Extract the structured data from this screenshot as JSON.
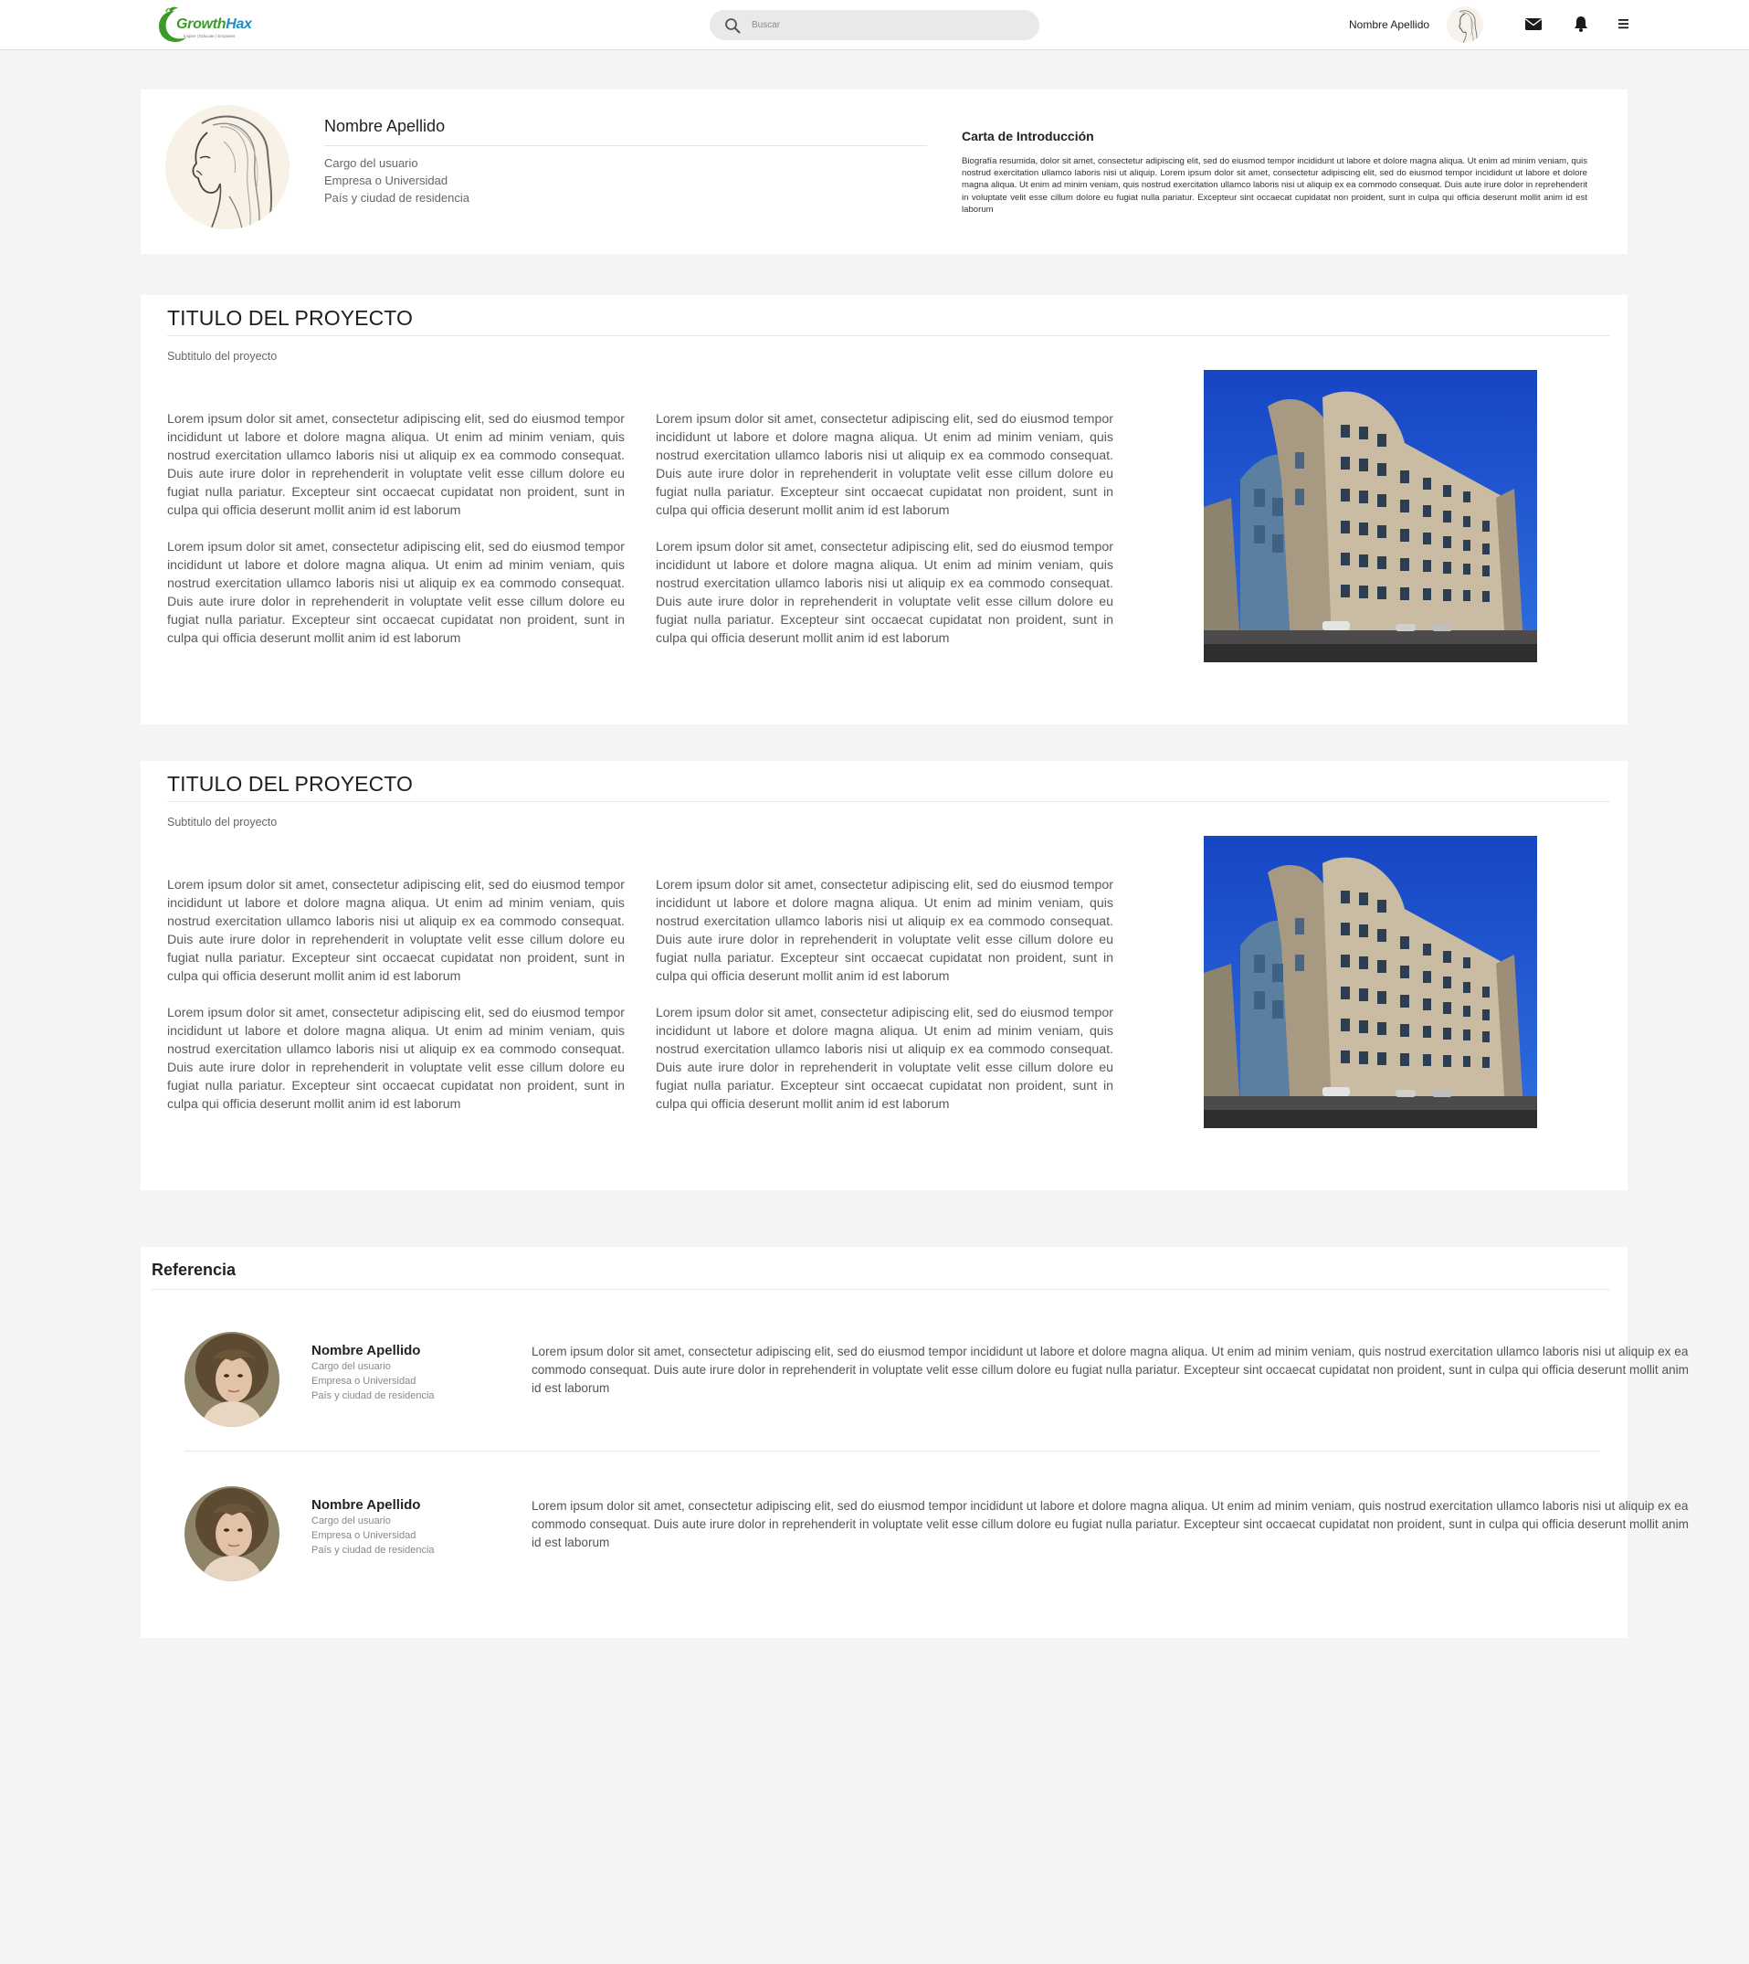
{
  "header": {
    "logo": {
      "part1": "Growth",
      "part2": "Hax",
      "tagline": "Inspire | Educate | Empower"
    },
    "search": {
      "placeholder": "Buscar"
    },
    "user_name": "Nombre Apellido",
    "icons": [
      "mail-icon",
      "bell-icon",
      "menu-icon"
    ]
  },
  "profile": {
    "name": "Nombre Apellido",
    "position": "Cargo del usuario",
    "organization": "Empresa o Universidad",
    "location": "País y ciudad de residencia",
    "intro_title": "Carta de Introducción",
    "intro_text": "Biografía resumida, dolor sit amet, consectetur adipiscing elit, sed do eiusmod tempor incididunt ut labore et dolore magna aliqua. Ut enim ad minim veniam, quis nostrud exercitation ullamco laboris nisi ut aliquip. Lorem ipsum dolor sit amet, consectetur adipiscing elit, sed do eiusmod tempor incididunt ut labore et dolore magna aliqua. Ut enim ad minim veniam, quis nostrud exercitation ullamco laboris nisi ut aliquip ex ea commodo consequat. Duis aute irure dolor in reprehenderit in voluptate velit esse cillum dolore eu fugiat nulla pariatur. Excepteur sint occaecat cupidatat non proident, sunt in culpa qui officia deserunt mollit anim id est laborum"
  },
  "projects": [
    {
      "title": "TITULO DEL PROYECTO",
      "subtitle": "Subtitulo del proyecto",
      "paragraphs": [
        "Lorem ipsum dolor sit amet, consectetur adipiscing elit, sed do eiusmod tempor incididunt ut labore et dolore magna aliqua. Ut enim ad minim veniam, quis nostrud exercitation ullamco laboris nisi ut aliquip ex ea commodo consequat. Duis aute irure dolor in reprehenderit in voluptate velit esse cillum dolore eu fugiat nulla pariatur. Excepteur sint occaecat cupidatat non proident, sunt in culpa qui officia deserunt mollit anim id est laborum",
        "Lorem ipsum dolor sit amet, consectetur adipiscing elit, sed do eiusmod tempor incididunt ut labore et dolore magna aliqua. Ut enim ad minim veniam, quis nostrud exercitation ullamco laboris nisi ut aliquip ex ea commodo consequat. Duis aute irure dolor in reprehenderit in voluptate velit esse cillum dolore eu fugiat nulla pariatur. Excepteur sint occaecat cupidatat non proident, sunt in culpa qui officia deserunt mollit anim id est laborum",
        "Lorem ipsum dolor sit amet, consectetur adipiscing elit, sed do eiusmod tempor incididunt ut labore et dolore magna aliqua. Ut enim ad minim veniam, quis nostrud exercitation ullamco laboris nisi ut aliquip ex ea commodo consequat. Duis aute irure dolor in reprehenderit in voluptate velit esse cillum dolore eu fugiat nulla pariatur. Excepteur sint occaecat cupidatat non proident, sunt in culpa qui officia deserunt mollit anim id est laborum",
        "Lorem ipsum dolor sit amet, consectetur adipiscing elit, sed do eiusmod tempor incididunt ut labore et dolore magna aliqua. Ut enim ad minim veniam, quis nostrud exercitation ullamco laboris nisi ut aliquip ex ea commodo consequat. Duis aute irure dolor in reprehenderit in voluptate velit esse cillum dolore eu fugiat nulla pariatur. Excepteur sint occaecat cupidatat non proident, sunt in culpa qui officia deserunt mollit anim id est laborum"
      ]
    },
    {
      "title": "TITULO DEL PROYECTO",
      "subtitle": "Subtitulo del proyecto",
      "paragraphs": [
        "Lorem ipsum dolor sit amet, consectetur adipiscing elit, sed do eiusmod tempor incididunt ut labore et dolore magna aliqua. Ut enim ad minim veniam, quis nostrud exercitation ullamco laboris nisi ut aliquip ex ea commodo consequat. Duis aute irure dolor in reprehenderit in voluptate velit esse cillum dolore eu fugiat nulla pariatur. Excepteur sint occaecat cupidatat non proident, sunt in culpa qui officia deserunt mollit anim id est laborum",
        "Lorem ipsum dolor sit amet, consectetur adipiscing elit, sed do eiusmod tempor incididunt ut labore et dolore magna aliqua. Ut enim ad minim veniam, quis nostrud exercitation ullamco laboris nisi ut aliquip ex ea commodo consequat. Duis aute irure dolor in reprehenderit in voluptate velit esse cillum dolore eu fugiat nulla pariatur. Excepteur sint occaecat cupidatat non proident, sunt in culpa qui officia deserunt mollit anim id est laborum",
        "Lorem ipsum dolor sit amet, consectetur adipiscing elit, sed do eiusmod tempor incididunt ut labore et dolore magna aliqua. Ut enim ad minim veniam, quis nostrud exercitation ullamco laboris nisi ut aliquip ex ea commodo consequat. Duis aute irure dolor in reprehenderit in voluptate velit esse cillum dolore eu fugiat nulla pariatur. Excepteur sint occaecat cupidatat non proident, sunt in culpa qui officia deserunt mollit anim id est laborum",
        "Lorem ipsum dolor sit amet, consectetur adipiscing elit, sed do eiusmod tempor incididunt ut labore et dolore magna aliqua. Ut enim ad minim veniam, quis nostrud exercitation ullamco laboris nisi ut aliquip ex ea commodo consequat. Duis aute irure dolor in reprehenderit in voluptate velit esse cillum dolore eu fugiat nulla pariatur. Excepteur sint occaecat cupidatat non proident, sunt in culpa qui officia deserunt mollit anim id est laborum"
      ]
    }
  ],
  "references": {
    "title": "Referencia",
    "items": [
      {
        "name": "Nombre Apellido",
        "position": "Cargo del usuario",
        "organization": "Empresa o Universidad",
        "location": "País y ciudad de residencia",
        "text": "Lorem ipsum dolor sit amet, consectetur adipiscing elit, sed do eiusmod tempor incididunt ut labore et dolore magna aliqua. Ut enim ad minim veniam, quis nostrud exercitation ullamco laboris nisi ut aliquip ex ea commodo consequat. Duis aute irure dolor in reprehenderit in voluptate velit esse cillum dolore eu fugiat nulla pariatur. Excepteur sint occaecat cupidatat non proident, sunt in culpa qui officia deserunt mollit anim id est laborum"
      },
      {
        "name": "Nombre Apellido",
        "position": "Cargo del usuario",
        "organization": "Empresa o Universidad",
        "location": "País y ciudad de residencia",
        "text": "Lorem ipsum dolor sit amet, consectetur adipiscing elit, sed do eiusmod tempor incididunt ut labore et dolore magna aliqua. Ut enim ad minim veniam, quis nostrud exercitation ullamco laboris nisi ut aliquip ex ea commodo consequat. Duis aute irure dolor in reprehenderit in voluptate velit esse cillum dolore eu fugiat nulla pariatur. Excepteur sint occaecat cupidatat non proident, sunt in culpa qui officia deserunt mollit anim id est laborum"
      }
    ]
  },
  "colors": {
    "page_background": "#f4f4f5",
    "card_background": "#ffffff",
    "logo_green": "#3a9b27",
    "logo_blue": "#1f8bc7",
    "search_background": "#e9e9ea"
  }
}
